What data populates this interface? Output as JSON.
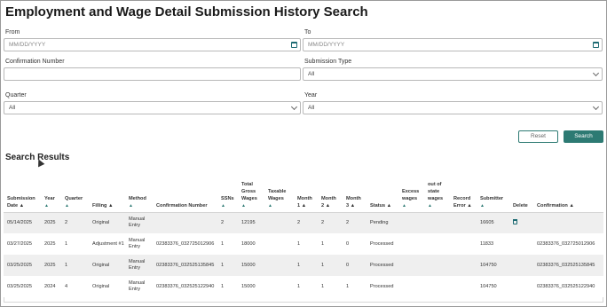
{
  "page": {
    "title": "Employment and Wage Detail Submission History Search"
  },
  "form": {
    "from_label": "From",
    "from_placeholder": "MM/DD/YYYY",
    "to_label": "To",
    "to_placeholder": "MM/DD/YYYY",
    "confirmation_label": "Confirmation Number",
    "confirmation_value": "",
    "submission_type_label": "Submission Type",
    "submission_type_value": "All",
    "quarter_label": "Quarter",
    "quarter_value": "All",
    "year_label": "Year",
    "year_value": "All",
    "reset_label": "Reset",
    "search_label": "Search"
  },
  "results": {
    "title": "Search Results",
    "sort_glyph": "▲",
    "columns": [
      [
        "Submission",
        "Date ▲"
      ],
      [
        "Year",
        "▲"
      ],
      [
        "Quarter",
        "▲"
      ],
      [
        "Filling ▲"
      ],
      [
        "Method",
        "▲"
      ],
      [
        "Confirmation Number"
      ],
      [
        "SSNs",
        "▲"
      ],
      [
        "Total",
        "Gross",
        "Wages",
        "▲"
      ],
      [
        "Taxable",
        "Wages",
        "▲"
      ],
      [
        "Month",
        "1 ▲"
      ],
      [
        "Month",
        "2 ▲"
      ],
      [
        "Month",
        "3 ▲"
      ],
      [
        "Status ▲"
      ],
      [
        "Excess",
        "wages",
        "▲"
      ],
      [
        "out of",
        "state",
        "wages",
        "▲"
      ],
      [
        "Record",
        "Error ▲"
      ],
      [
        "Submitter",
        "▲"
      ],
      [
        "Delete"
      ],
      [
        "Confirmation ▲"
      ]
    ],
    "rows": [
      {
        "date": "05/14/2025",
        "year": "2025",
        "quarter": "2",
        "filling": "Original",
        "method_1": "Manual",
        "method_2": "Entry",
        "confirmation_number": "",
        "ssns": "2",
        "total_gross_wages": "12195",
        "taxable_wages": "",
        "month_1": "2",
        "month_2": "2",
        "month_3": "2",
        "status": "Pending",
        "excess_wages": "",
        "out_of_state_wages": "",
        "record_error": "",
        "submitter": "16605",
        "delete": true,
        "confirmation": ""
      },
      {
        "date": "03/27/2025",
        "year": "2025",
        "quarter": "1",
        "filling": "Adjustment #1",
        "method_1": "Manual",
        "method_2": "Entry",
        "confirmation_number": "02383376_032725012906",
        "ssns": "1",
        "total_gross_wages": "18000",
        "taxable_wages": "",
        "month_1": "1",
        "month_2": "1",
        "month_3": "0",
        "status": "Processed",
        "excess_wages": "",
        "out_of_state_wages": "",
        "record_error": "",
        "submitter": "11833",
        "delete": false,
        "confirmation": "02383376_032725012906"
      },
      {
        "date": "03/25/2025",
        "year": "2025",
        "quarter": "1",
        "filling": "Original",
        "method_1": "Manual",
        "method_2": "Entry",
        "confirmation_number": "02383376_032525135845",
        "ssns": "1",
        "total_gross_wages": "15000",
        "taxable_wages": "",
        "month_1": "1",
        "month_2": "1",
        "month_3": "0",
        "status": "Processed",
        "excess_wages": "",
        "out_of_state_wages": "",
        "record_error": "",
        "submitter": "104750",
        "delete": false,
        "confirmation": "02383376_032525135845"
      },
      {
        "date": "03/25/2025",
        "year": "2024",
        "quarter": "4",
        "filling": "Original",
        "method_1": "Manual",
        "method_2": "Entry",
        "confirmation_number": "02383376_032525122940",
        "ssns": "1",
        "total_gross_wages": "15000",
        "taxable_wages": "",
        "month_1": "1",
        "month_2": "1",
        "month_3": "1",
        "status": "Processed",
        "excess_wages": "",
        "out_of_state_wages": "",
        "record_error": "",
        "submitter": "104750",
        "delete": false,
        "confirmation": "02383376_032525122940"
      }
    ]
  },
  "colors": {
    "accent": "#2d7a73",
    "row_alt": "#efefef",
    "border": "#b8b8b8"
  }
}
